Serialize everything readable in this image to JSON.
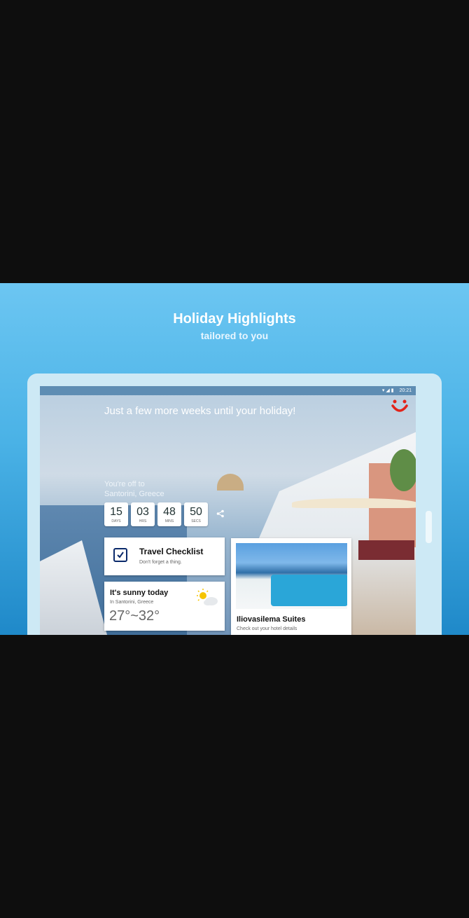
{
  "promo": {
    "title": "Holiday Highlights",
    "subtitle": "tailored to you"
  },
  "statusbar": {
    "time": "20:21"
  },
  "hero": {
    "tagline": "Just a few more weeks until your holiday!",
    "off_to_label": "You're off to",
    "destination": "Santorini, Greece"
  },
  "countdown": [
    {
      "value": "15",
      "unit": "DAYS"
    },
    {
      "value": "03",
      "unit": "HRS"
    },
    {
      "value": "48",
      "unit": "MINS"
    },
    {
      "value": "50",
      "unit": "SECS"
    }
  ],
  "checklist": {
    "title": "Travel Checklist",
    "subtitle": "Don't forget a thing."
  },
  "weather": {
    "title": "It's sunny today",
    "location": "In Santorini, Greece",
    "temp_range": "27°~32°"
  },
  "hotel": {
    "name": "Iliovasilema Suites",
    "subtitle": "Check out your hotel details"
  },
  "colors": {
    "brand_red": "#e2231a",
    "navy": "#0b2a6b",
    "sky": "#6cc6f2"
  }
}
